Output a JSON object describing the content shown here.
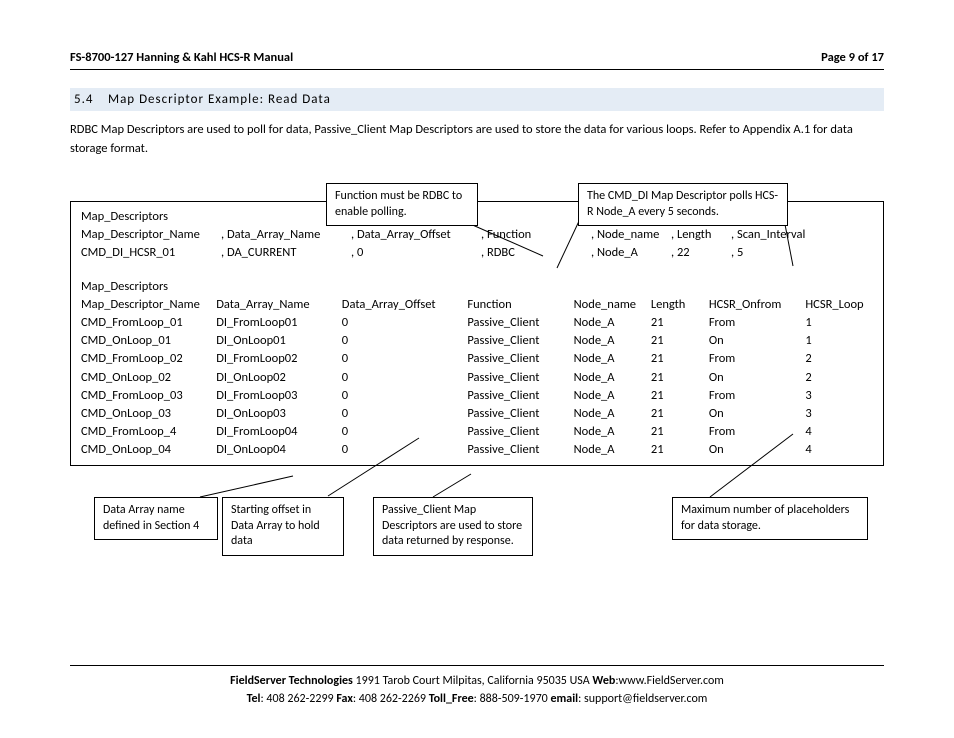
{
  "header": {
    "doc_title": "FS-8700-127 Hanning & Kahl HCS-R Manual",
    "page_label": "Page 9 of 17"
  },
  "section": {
    "number": "5.4",
    "title": "Map Descriptor Example: Read Data"
  },
  "intro": "RDBC Map Descriptors are used to poll for data, Passive_Client Map Descriptors are used to store the data for various loops. Refer to Appendix A.1 for data storage format.",
  "callouts": {
    "top_left": "Function must be RDBC to enable polling.",
    "top_right": "The CMD_DI Map Descriptor polls HCS-R Node_A every 5 seconds.",
    "bottom_1": "Data Array name defined in Section 4",
    "bottom_2": "Starting offset in Data Array to hold data",
    "bottom_3": "Passive_Client Map Descriptors are used to store data returned by response.",
    "bottom_4": "Maximum number of placeholders for data storage."
  },
  "block1": {
    "title": "Map_Descriptors",
    "headers": {
      "c1": "Map_Descriptor_Name",
      "c2": ", Data_Array_Name",
      "c3": ", Data_Array_Offset",
      "c4": ", Function",
      "c5": ", Node_name",
      "c6": ", Length",
      "c7": ", Scan_Interval"
    },
    "row": {
      "c1": "CMD_DI_HCSR_01",
      "c2": ", DA_CURRENT",
      "c3": ", 0",
      "c4": ", RDBC",
      "c5": ", Node_A",
      "c6": ", 22",
      "c7": ", 5"
    }
  },
  "block2": {
    "title": "Map_Descriptors",
    "headers": {
      "c1": "Map_Descriptor_Name",
      "c2": "Data_Array_Name",
      "c3": "Data_Array_Offset",
      "c4": "Function",
      "c5": "Node_name",
      "c6": "Length",
      "c7": "HCSR_Onfrom",
      "c8": "HCSR_Loop"
    },
    "rows": [
      {
        "c1": "CMD_FromLoop_01",
        "c2": "DI_FromLoop01",
        "c3": "0",
        "c4": "Passive_Client",
        "c5": "Node_A",
        "c6": "21",
        "c7": "From",
        "c8": "1"
      },
      {
        "c1": "CMD_OnLoop_01",
        "c2": "DI_OnLoop01",
        "c3": "0",
        "c4": "Passive_Client",
        "c5": "Node_A",
        "c6": "21",
        "c7": "On",
        "c8": "1"
      },
      {
        "c1": "CMD_FromLoop_02",
        "c2": "DI_FromLoop02",
        "c3": "0",
        "c4": "Passive_Client",
        "c5": "Node_A",
        "c6": "21",
        "c7": "From",
        "c8": "2"
      },
      {
        "c1": "CMD_OnLoop_02",
        "c2": "DI_OnLoop02",
        "c3": "0",
        "c4": "Passive_Client",
        "c5": "Node_A",
        "c6": "21",
        "c7": "On",
        "c8": "2"
      },
      {
        "c1": "CMD_FromLoop_03",
        "c2": "DI_FromLoop03",
        "c3": "0",
        "c4": "Passive_Client",
        "c5": "Node_A",
        "c6": "21",
        "c7": "From",
        "c8": "3"
      },
      {
        "c1": "CMD_OnLoop_03",
        "c2": "DI_OnLoop03",
        "c3": "0",
        "c4": "Passive_Client",
        "c5": "Node_A",
        "c6": "21",
        "c7": "On",
        "c8": "3"
      },
      {
        "c1": "CMD_FromLoop_4",
        "c2": "DI_FromLoop04",
        "c3": "0",
        "c4": "Passive_Client",
        "c5": "Node_A",
        "c6": "21",
        "c7": "From",
        "c8": "4"
      },
      {
        "c1": "CMD_OnLoop_04",
        "c2": "DI_OnLoop04",
        "c3": "0",
        "c4": "Passive_Client",
        "c5": "Node_A",
        "c6": "21",
        "c7": "On",
        "c8": "4"
      }
    ]
  },
  "footer": {
    "line1_a": "FieldServer Technologies",
    "line1_b": " 1991 Tarob Court Milpitas, California 95035 USA ",
    "web_label": "Web",
    "web_val": ":www.FieldServer.com",
    "tel_label": "Tel",
    "tel_val": ": 408 262-2299 ",
    "fax_label": "Fax",
    "fax_val": ": 408 262-2269 ",
    "tf_label": "Toll_Free",
    "tf_val": ": 888-509-1970 ",
    "email_label": "email",
    "email_val": ": support@fieldserver.com"
  }
}
